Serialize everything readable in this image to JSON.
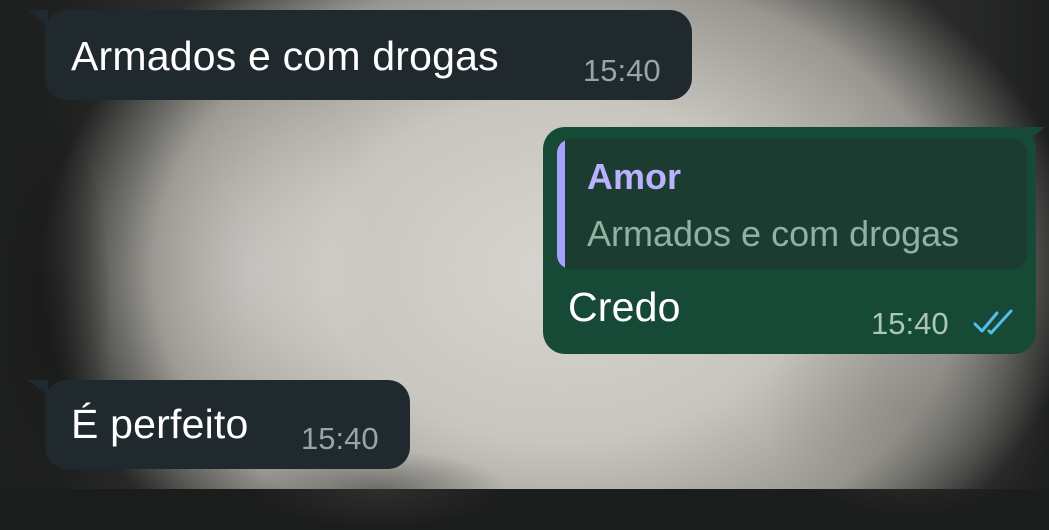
{
  "messages": [
    {
      "direction": "incoming",
      "text": "Armados e com drogas",
      "time": "15:40"
    },
    {
      "direction": "outgoing",
      "reply": {
        "author": "Amor",
        "text": "Armados e com drogas"
      },
      "text": "Credo",
      "time": "15:40",
      "status": "read",
      "status_icon": "double-check-icon"
    },
    {
      "direction": "incoming",
      "text": "É perfeito",
      "time": "15:40"
    }
  ],
  "colors": {
    "incoming_bubble": "#202a2e",
    "outgoing_bubble": "#174a36",
    "quote_accent": "#a8a0ff",
    "read_ticks": "#53bdeb"
  }
}
